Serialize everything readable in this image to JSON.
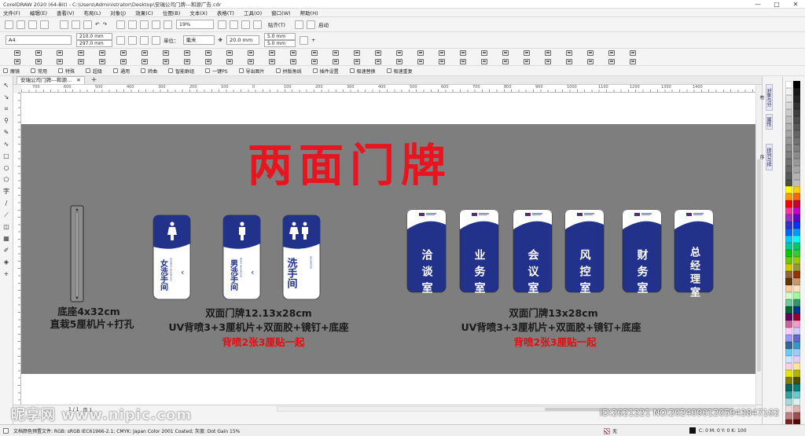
{
  "window": {
    "title": "CorelDRAW 2020 (64-Bit) - C:\\Users\\Administrator\\Desktop\\安瑞公司门牌---和源广告.cdr",
    "minimize": "—",
    "maximize": "□",
    "close": "✕"
  },
  "menu": [
    "文件(F)",
    "编辑(E)",
    "查看(V)",
    "布局(L)",
    "对象(J)",
    "效果(C)",
    "位图(B)",
    "文本(X)",
    "表格(T)",
    "工具(O)",
    "窗口(W)",
    "帮助(H)"
  ],
  "standard_toolbar": {
    "zoom": "19%",
    "snap_label": "贴齐(T)",
    "launch_label": "启动"
  },
  "property_bar": {
    "page_size": "A4",
    "width": "210.0 mm",
    "height": "297.0 mm",
    "units_label": "单位：",
    "units": "毫米",
    "nudge": "20.0 mm",
    "dup_x": "5.0 mm",
    "dup_y": "5.0 mm"
  },
  "plugins": [
    "魔镜",
    "常用",
    "特殊",
    "超级",
    "通用",
    "转曲",
    "智能群组",
    "一键PS",
    "导出图片",
    "拼版角线",
    "插件设置",
    "极速替换",
    "极速重复"
  ],
  "doc_tab": {
    "label": "安瑞公司门牌---和源...",
    "close": "✕",
    "add": "+"
  },
  "ruler": {
    "marks": [
      "700",
      "600",
      "500",
      "400",
      "300",
      "200",
      "100",
      "0",
      "100",
      "200",
      "300",
      "400",
      "500",
      "600",
      "700",
      "800",
      "900",
      "1000",
      "1100",
      "1200",
      "1300",
      "1400"
    ]
  },
  "dockers": [
    "对象与分布",
    "属性",
    "排列与排序"
  ],
  "design": {
    "title": "两面门牌",
    "base": {
      "line1": "底座4x32cm",
      "line2": "直栽5厘机片+打孔"
    },
    "group1": {
      "line1": "双面门牌12.13x28cm",
      "line2": "UV背喷3+3厘机片+双面胶+镜钉+底座",
      "note": "背喷2张3厘贴一起",
      "signs": [
        {
          "text": "女洗手间",
          "sub": "WOMEN'S WASHROOM",
          "arrow": "‹"
        },
        {
          "text": "男洗手间",
          "sub": "MEN'S WASHROOM",
          "arrow": "‹"
        },
        {
          "text": "洗手间",
          "sub": "WASHROOM",
          "arrow": ""
        }
      ]
    },
    "group2": {
      "line1": "双面门牌13x28cm",
      "line2": "UV背喷3+3厘机片+双面胶+镜钉+底座",
      "note": "背喷2张3厘贴一起",
      "signs": [
        "洽谈室",
        "业务室",
        "会议室",
        "风控室",
        "财务室",
        "总经理室"
      ]
    }
  },
  "page_nav": {
    "pos": "1 / 1",
    "page": "页 1"
  },
  "status": {
    "profile": "文档颜色预置文件: RGB: sRGB IEC61966-2.1; CMYK: Japan Color 2001 Coated; 灰度: Dot Gain 15%",
    "fill": "无",
    "cmyk": "C: 0 M: 0 Y: 0 K: 100"
  },
  "watermark": {
    "left": "昵享网 www.nipic.com",
    "right": "ID:2621221 NO:20240901205943847102"
  },
  "colors": {
    "sign_blue": "#223189",
    "title_red": "#e8141e",
    "board_gray": "#7e7e7e"
  }
}
